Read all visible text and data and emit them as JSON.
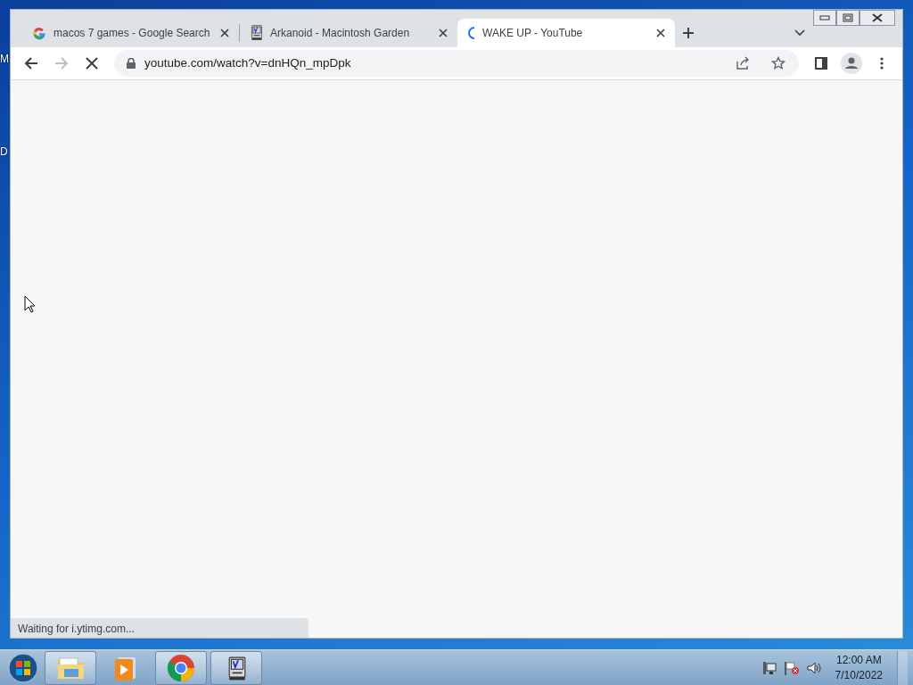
{
  "desktop": {
    "icon_labels": [
      "M",
      "D"
    ]
  },
  "browser": {
    "tabs": [
      {
        "title": "macos 7 games - Google Search",
        "kind": "google",
        "selected": false,
        "loading": false
      },
      {
        "title": "Arkanoid - Macintosh Garden",
        "kind": "mac",
        "selected": false,
        "loading": false
      },
      {
        "title": "WAKE UP - YouTube",
        "selected": true,
        "loading": true
      }
    ],
    "address": "youtube.com/watch?v=dnHQn_mpDpk",
    "loading": true,
    "status": "Waiting for i.ytimg.com..."
  },
  "taskbar": {
    "apps": [
      {
        "kind": "explorer",
        "running": true
      },
      {
        "kind": "media",
        "running": false
      },
      {
        "kind": "chrome",
        "running": true
      },
      {
        "kind": "mac",
        "running": true
      }
    ],
    "clock": {
      "time": "12:00 AM",
      "date": "7/10/2022"
    }
  }
}
